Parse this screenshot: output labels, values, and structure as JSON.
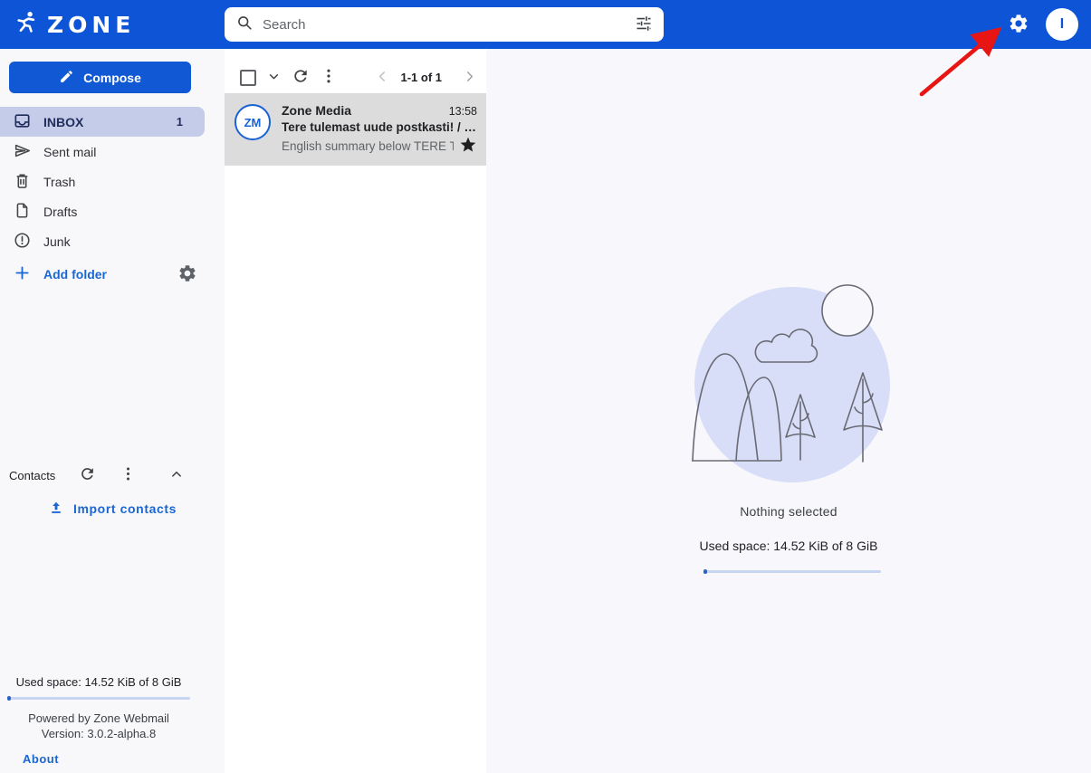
{
  "header": {
    "brand": "ZONE",
    "search": {
      "placeholder": "Search"
    },
    "avatar_initial": "I"
  },
  "sidebar": {
    "compose_label": "Compose",
    "folders": [
      {
        "label": "INBOX",
        "count": "1",
        "icon": "inbox-icon",
        "active": true
      },
      {
        "label": "Sent mail",
        "icon": "send-icon"
      },
      {
        "label": "Trash",
        "icon": "trash-icon"
      },
      {
        "label": "Drafts",
        "icon": "draft-icon"
      },
      {
        "label": "Junk",
        "icon": "junk-icon"
      }
    ],
    "add_folder_label": "Add folder",
    "contacts_title": "Contacts",
    "import_contacts_label": "Import contacts",
    "footer": {
      "used_space": "Used space: 14.52 KiB of 8 GiB",
      "powered_by": "Powered by Zone Webmail",
      "version": "Version: 3.0.2-alpha.8",
      "about_label": "About"
    }
  },
  "message_list": {
    "pagination_label": "1-1 of 1",
    "emails": [
      {
        "avatar_initials": "ZM",
        "sender": "Zone Media",
        "time": "13:58",
        "subject": "Tere tulemast uude postkasti! / …",
        "preview": "English summary below TERE T…",
        "starred": true
      }
    ]
  },
  "main": {
    "empty_state_label": "Nothing selected",
    "used_space": "Used space: 14.52 KiB of 8 GiB"
  },
  "annotation": {
    "shape": "red-arrow",
    "points_to": "settings-gear-icon"
  },
  "colors": {
    "header_blue": "#0d55d6",
    "accent_blue": "#1158d4",
    "link_blue": "#1a67d2",
    "active_folder_bg": "#c4cce9",
    "active_folder_text": "#1f2c5c",
    "email_row_bg": "#dcdcdc",
    "illustration_bg": "#d8def7",
    "progress_track": "#c7d6f0",
    "progress_fill": "#2b61c6",
    "arrow_red": "#e81515"
  }
}
